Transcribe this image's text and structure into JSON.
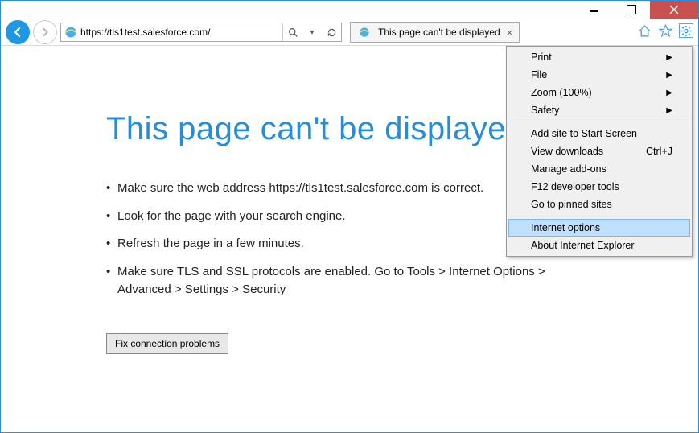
{
  "window": {
    "minimize_tip": "Minimize",
    "maximize_tip": "Maximize",
    "close_tip": "Close"
  },
  "nav": {
    "url": "https://tls1test.salesforce.com/",
    "search_icon": "search",
    "refresh_icon": "refresh"
  },
  "tab": {
    "title": "This page can't be displayed"
  },
  "toolbar_icons": {
    "home": "home-icon",
    "favorites": "favorites-icon",
    "tools": "gear-icon"
  },
  "error": {
    "heading": "This page can't be displayed",
    "tips": [
      "Make sure the web address https://tls1test.salesforce.com is correct.",
      "Look for the page with your search engine.",
      "Refresh the page in a few minutes.",
      "Make sure TLS and SSL protocols are enabled. Go to Tools > Internet Options > Advanced > Settings > Security"
    ],
    "fix_button": "Fix connection problems"
  },
  "menu": {
    "items": [
      {
        "label": "Print",
        "submenu": true
      },
      {
        "label": "File",
        "submenu": true
      },
      {
        "label": "Zoom (100%)",
        "submenu": true
      },
      {
        "label": "Safety",
        "submenu": true
      }
    ],
    "items2": [
      {
        "label": "Add site to Start Screen"
      },
      {
        "label": "View downloads",
        "shortcut": "Ctrl+J"
      },
      {
        "label": "Manage add-ons"
      },
      {
        "label": "F12 developer tools"
      },
      {
        "label": "Go to pinned sites"
      }
    ],
    "items3": [
      {
        "label": "Internet options",
        "highlight": true
      },
      {
        "label": "About Internet Explorer"
      }
    ]
  }
}
